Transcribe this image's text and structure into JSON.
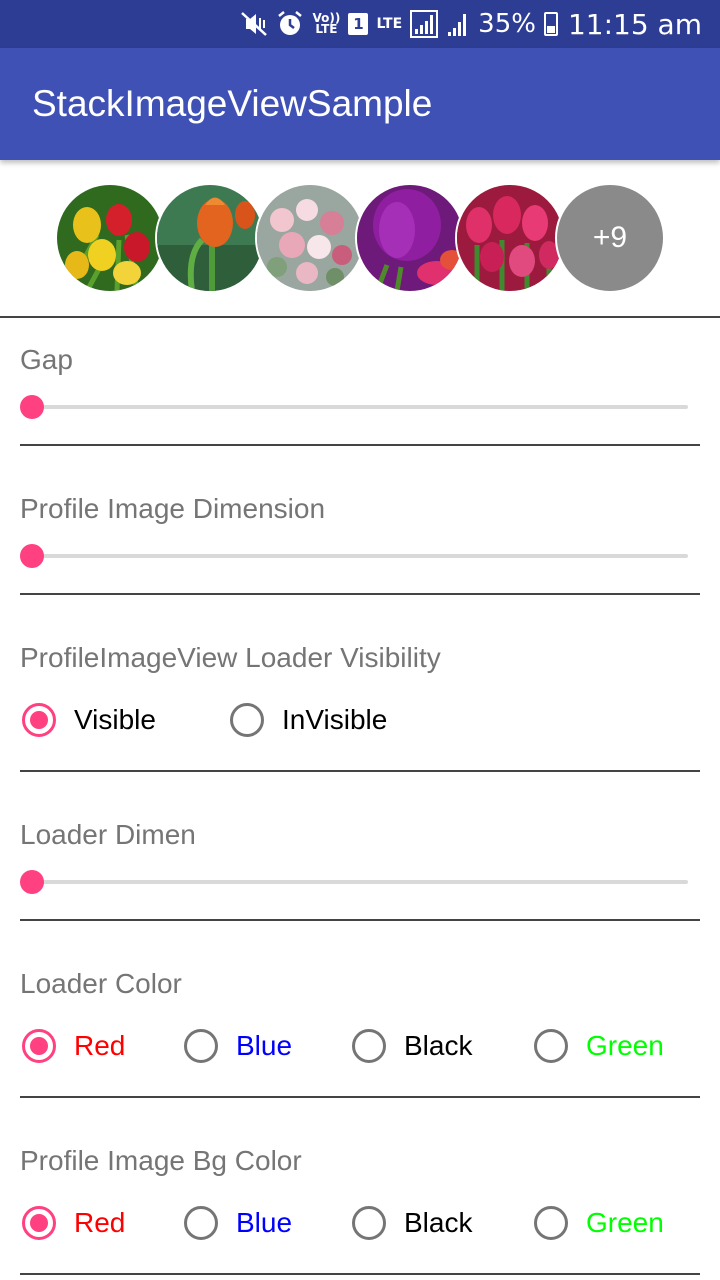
{
  "status_bar": {
    "icons": [
      "mute-vibrate-icon",
      "alarm-icon",
      "volte-icon",
      "sim-1-icon",
      "lte-icon",
      "signal-icon",
      "signal-icon-2",
      "battery-icon"
    ],
    "volte_label": "Vo)) LTE",
    "sim_label": "1",
    "lte_label": "LTE",
    "battery": "35%",
    "time": "11:15 am",
    "color": "#2d3d94"
  },
  "app_bar": {
    "title": "StackImageViewSample",
    "color": "#3f51b5"
  },
  "stack": {
    "images": [
      "tulips-red-yellow-image",
      "orange-tulip-image",
      "pink-flower-bouquet-image",
      "purple-tulip-image",
      "pink-tulips-image"
    ],
    "more_label": "+9"
  },
  "gap": {
    "label": "Gap",
    "value": 0
  },
  "profile_image_dimension": {
    "label": "Profile Image Dimension",
    "value": 0
  },
  "loader_visibility": {
    "label": "ProfileImageView Loader Visibility",
    "options": [
      {
        "label": "Visible",
        "checked": true
      },
      {
        "label": "InVisible",
        "checked": false
      }
    ]
  },
  "loader_dimen": {
    "label": "Loader Dimen",
    "value": 0
  },
  "loader_color": {
    "label": "Loader Color",
    "options": [
      {
        "label": "Red",
        "color": "#ff0000",
        "checked": true
      },
      {
        "label": "Blue",
        "color": "#0000ff",
        "checked": false
      },
      {
        "label": "Black",
        "color": "#000000",
        "checked": false
      },
      {
        "label": "Green",
        "color": "#00ff00",
        "checked": false
      }
    ]
  },
  "profile_image_bg_color": {
    "label": "Profile Image Bg Color",
    "options": [
      {
        "label": "Red",
        "color": "#ff0000",
        "checked": true
      },
      {
        "label": "Blue",
        "color": "#0000ff",
        "checked": false
      },
      {
        "label": "Black",
        "color": "#000000",
        "checked": false
      },
      {
        "label": "Green",
        "color": "#00ff00",
        "checked": false
      }
    ]
  },
  "accent_color": "#ff4081"
}
